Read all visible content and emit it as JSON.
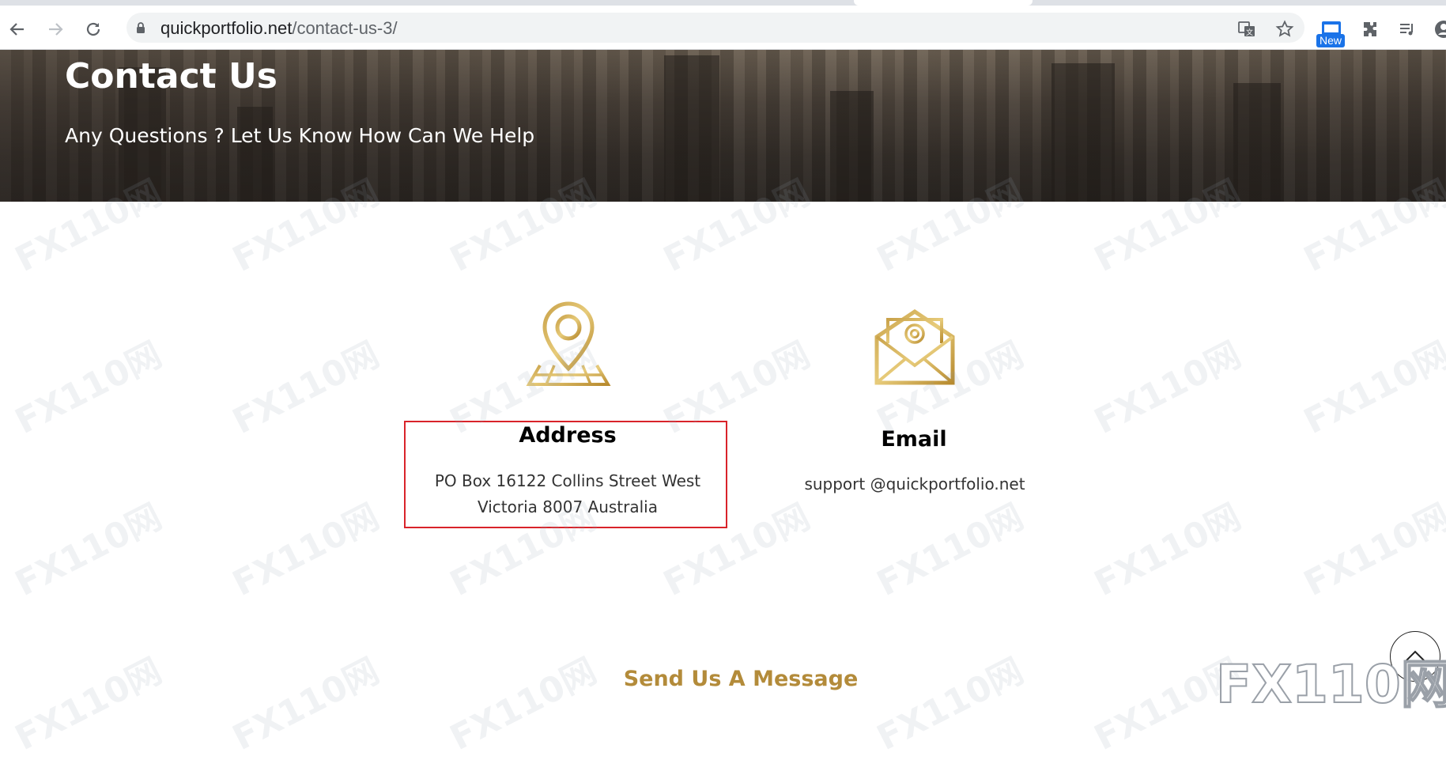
{
  "browser": {
    "url_host": "quickportfolio.net",
    "url_path": "/contact-us-3/",
    "new_badge": "New"
  },
  "hero": {
    "title": "Contact Us",
    "subtitle": "Any Questions ? Let Us Know How Can We Help"
  },
  "contact": {
    "address": {
      "icon": "map-pin-icon",
      "title": "Address",
      "line1": "PO Box 16122 Collins Street West",
      "line2": "Victoria 8007 Australia"
    },
    "email": {
      "icon": "envelope-icon",
      "title": "Email",
      "value": "support @quickportfolio.net"
    }
  },
  "send_message": {
    "title": "Send Us A Message"
  },
  "watermark": {
    "text": "FX110网",
    "corner": "FX110网"
  },
  "colors": {
    "accent_gold": "#b38b3a",
    "highlight_red": "#d9232a"
  }
}
